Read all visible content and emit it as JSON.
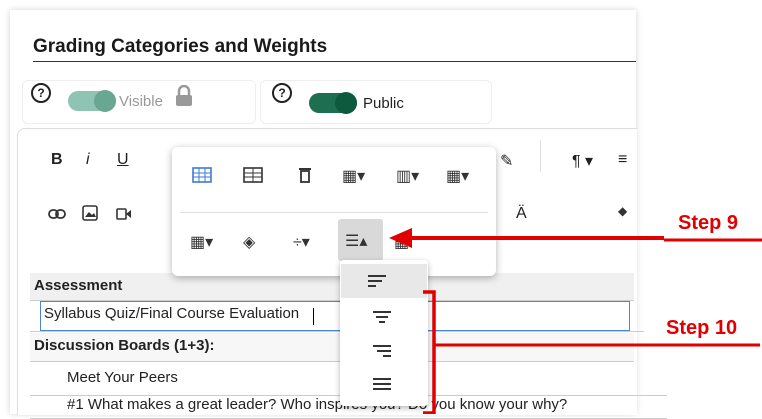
{
  "editor": {
    "title": "Grading Categories and Weights",
    "visible_label": "Visible",
    "public_label": "Public",
    "help_glyph": "?",
    "toolbar_row1": [
      "B",
      "i",
      "U"
    ],
    "toolbar_row1_right": [
      "¶ ▾",
      "≡"
    ]
  },
  "table_popup": {
    "items": [
      "table-properties",
      "table-cell",
      "delete-table",
      "row-menu",
      "column-menu",
      "cell-style",
      "cell-props",
      "fill-color",
      "vertical-split",
      "align-menu",
      "more"
    ],
    "align_options": [
      "align-left",
      "align-center",
      "align-right",
      "align-justify"
    ]
  },
  "table": {
    "rows": [
      {
        "text": "Assessment",
        "bold": true
      },
      {
        "text": "Syllabus Quiz/Final Course Evaluation",
        "bold": false
      },
      {
        "text": "Discussion Boards (1+3):",
        "bold": true
      },
      {
        "text": "Meet Your Peers",
        "bold": false
      },
      {
        "text": "#1 What makes a great leader? Who inspires you? Do you know your why?",
        "bold": false
      }
    ]
  },
  "annotations": {
    "step9": "Step 9",
    "step10": "Step 10",
    "color": "#e00000"
  }
}
